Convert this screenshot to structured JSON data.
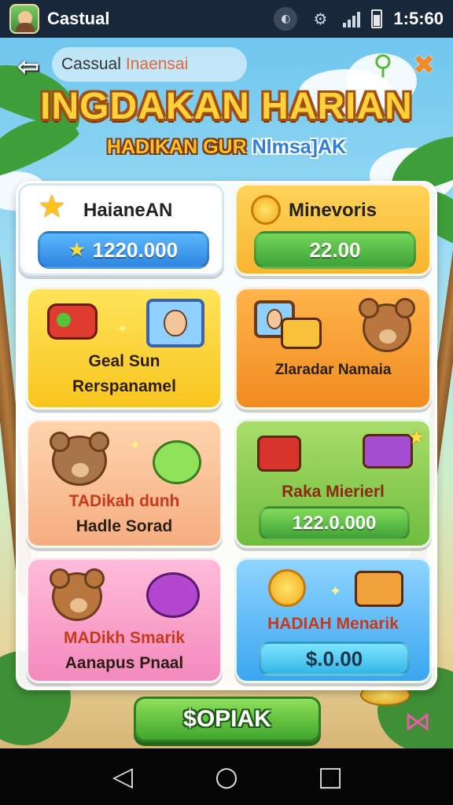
{
  "status_bar": {
    "app_name": "Castual",
    "time": "1:5:60"
  },
  "header": {
    "back_label": "⇦",
    "title_main": "Cassual",
    "title_highlight": "Inaensai",
    "search_icon": "search-icon",
    "close_icon": "close-icon"
  },
  "banner": {
    "title": "INGDAKAN HARIAN",
    "subtitle_a": "HADIKAN GUR",
    "subtitle_b": "Nlmsa]AK"
  },
  "stats": {
    "left": {
      "label": "HaianeAN",
      "value": "1220.000"
    },
    "right": {
      "label": "Minevoris",
      "value": "22.00"
    }
  },
  "cards": [
    {
      "line1": "Geal Sun",
      "line2": "Rerspanamel",
      "color": "#ffd93b"
    },
    {
      "line1": "Zlaradar Namaia",
      "color": "#f5a33a"
    },
    {
      "line1": "TADikah dunh",
      "line2": "Hadle Sorad",
      "color": "#f7c39a"
    },
    {
      "line1": "Raka Mierierl",
      "value": "122.0.000",
      "color": "#8fce55"
    },
    {
      "line1": "MADikh Smarik",
      "line2": "Aanapus Pnaal",
      "color": "#f7a6cf"
    },
    {
      "line1": "HADIAH Menarik",
      "value": "$.0.00",
      "color": "#5bb8f0"
    }
  ],
  "main_button": {
    "label": "$OPIAK"
  },
  "nav": {
    "back": "◁",
    "home": "○",
    "recents": "□"
  }
}
